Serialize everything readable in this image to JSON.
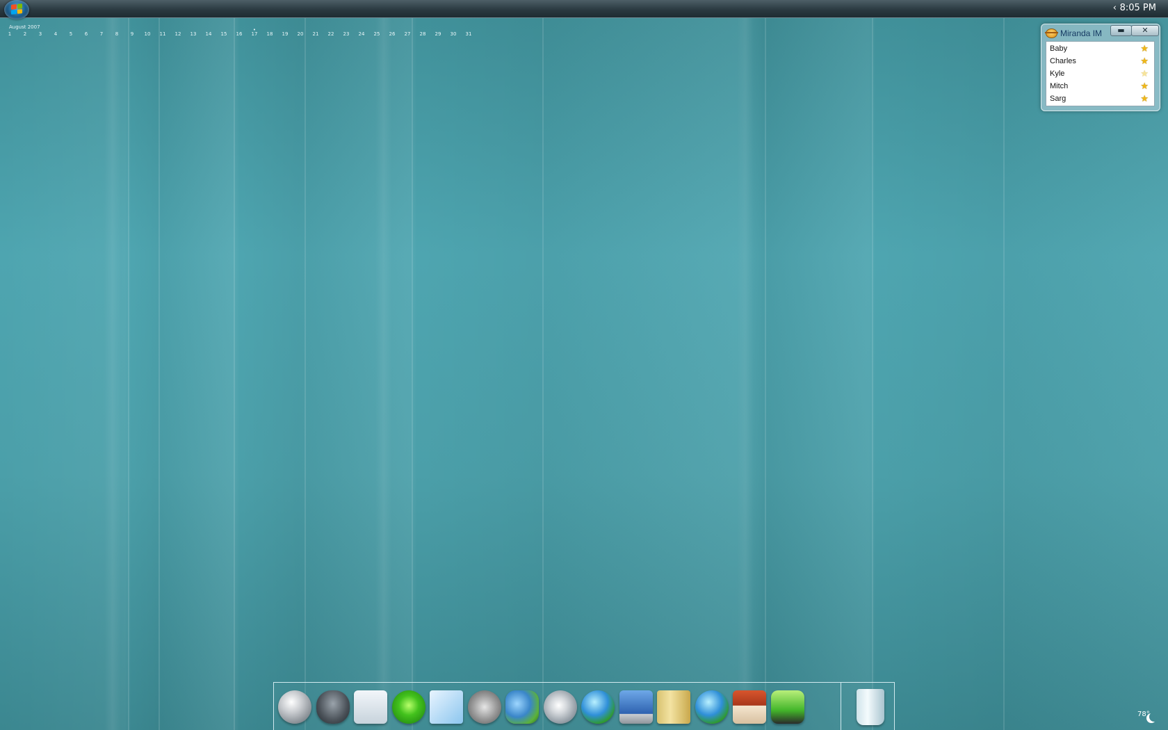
{
  "taskbar": {
    "clock": "8:05 PM",
    "tray_chevron": "‹"
  },
  "calendar": {
    "title": "August 2007",
    "days": [
      "1",
      "2",
      "3",
      "4",
      "5",
      "6",
      "7",
      "8",
      "9",
      "10",
      "11",
      "12",
      "13",
      "14",
      "15",
      "16",
      "17",
      "18",
      "19",
      "20",
      "21",
      "22",
      "23",
      "24",
      "25",
      "26",
      "27",
      "28",
      "29",
      "30",
      "31"
    ],
    "today": "17"
  },
  "miranda": {
    "title": "Miranda IM",
    "minimize_label": "▬",
    "close_label": "✕",
    "contacts": [
      {
        "name": "Baby",
        "status": "online"
      },
      {
        "name": "Charles",
        "status": "online"
      },
      {
        "name": "Kyle",
        "status": "away"
      },
      {
        "name": "Mitch",
        "status": "online"
      },
      {
        "name": "Sarg",
        "status": "online"
      }
    ]
  },
  "dock": {
    "items": [
      {
        "name": "media-disc-red-icon"
      },
      {
        "name": "game-controller-icon"
      },
      {
        "name": "calculator-icon"
      },
      {
        "name": "green-circle-app-icon"
      },
      {
        "name": "notepad-icon"
      },
      {
        "name": "film-reel-icon"
      },
      {
        "name": "messenger-users-icon"
      },
      {
        "name": "music-cd-icon"
      },
      {
        "name": "globe-icon"
      },
      {
        "name": "control-panel-icon"
      },
      {
        "name": "folder-documents-icon"
      },
      {
        "name": "network-globe-icon"
      },
      {
        "name": "home-icon"
      },
      {
        "name": "battery-power-icon"
      }
    ],
    "trash": {
      "name": "recycle-bin-icon"
    }
  },
  "weather": {
    "temperature": "78°"
  },
  "colors": {
    "desktop": "#4ea5b0",
    "taskbar": "#2b3a41",
    "star": "#f0b818"
  }
}
